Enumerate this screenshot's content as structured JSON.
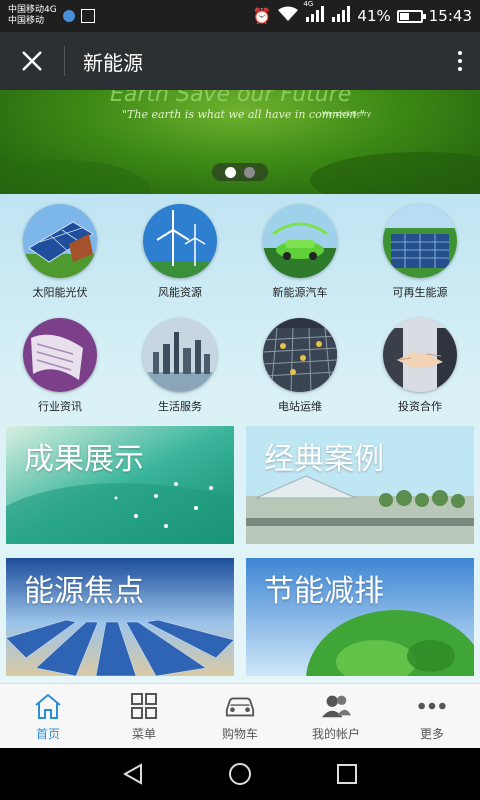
{
  "status_bar": {
    "carrier_1": "中国移动4G",
    "carrier_2": "中国移动",
    "network": "4G",
    "battery": "41%",
    "battery_level": 0.41,
    "time": "15:43"
  },
  "app_bar": {
    "title": "新能源",
    "close_icon": "close-icon",
    "more_icon": "more-vertical-icon"
  },
  "banner": {
    "headline": "Earth Save our Future",
    "quote": "\"The earth is what we all have in common.\"",
    "author": "Wendell Berry",
    "slides_total": 2,
    "slide_active": 1
  },
  "grid": [
    {
      "label": "太阳能光伏",
      "icon": "solar-panel-image"
    },
    {
      "label": "风能资源",
      "icon": "wind-turbine-image"
    },
    {
      "label": "新能源汽车",
      "icon": "green-car-image"
    },
    {
      "label": "可再生能源",
      "icon": "solar-field-image"
    },
    {
      "label": "行业资讯",
      "icon": "newspaper-image"
    },
    {
      "label": "生活服务",
      "icon": "city-skyline-image"
    },
    {
      "label": "电站运维",
      "icon": "power-station-image"
    },
    {
      "label": "投资合作",
      "icon": "handshake-image"
    }
  ],
  "tiles": [
    {
      "title": "成果展示"
    },
    {
      "title": "经典案例"
    },
    {
      "title": "能源焦点"
    },
    {
      "title": "节能减排"
    }
  ],
  "bottom_nav": [
    {
      "label": "首页",
      "icon": "home-icon",
      "active": true
    },
    {
      "label": "菜单",
      "icon": "menu-grid-icon",
      "active": false
    },
    {
      "label": "购物车",
      "icon": "car-icon",
      "active": false
    },
    {
      "label": "我的帐户",
      "icon": "account-icon",
      "active": false
    },
    {
      "label": "更多",
      "icon": "more-dots-icon",
      "active": false
    }
  ],
  "colors": {
    "app_bar": "#2d3033",
    "active_nav": "#2b8fd6",
    "content_bg": "#d9f1f6"
  }
}
